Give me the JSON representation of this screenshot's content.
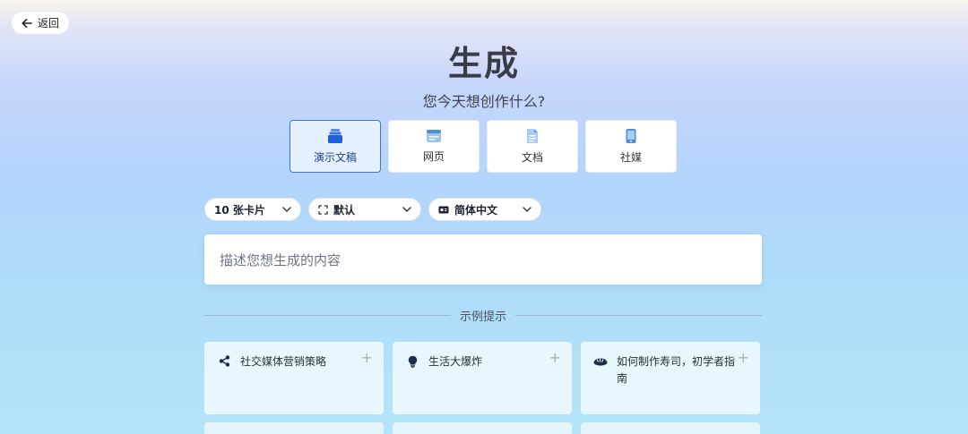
{
  "nav": {
    "back_label": "返回"
  },
  "header": {
    "title": "生成",
    "subtitle": "您今天想创作什么?"
  },
  "types": [
    {
      "label": "演示文稿",
      "icon": "presentation-icon",
      "active": true
    },
    {
      "label": "网页",
      "icon": "webpage-icon",
      "active": false
    },
    {
      "label": "文档",
      "icon": "document-icon",
      "active": false
    },
    {
      "label": "社媒",
      "icon": "social-media-icon",
      "active": false
    }
  ],
  "options": {
    "cards": "10 张卡片",
    "theme": "默认",
    "language": "简体中文"
  },
  "prompt": {
    "placeholder": "描述您想生成的内容"
  },
  "examples": {
    "heading": "示例提示",
    "items": [
      {
        "text": "社交媒体营销策略",
        "icon": "share-icon"
      },
      {
        "text": "生活大爆炸",
        "icon": "lightbulb-icon"
      },
      {
        "text": "如何制作寿司，初学者指南",
        "icon": "sushi-icon"
      }
    ]
  },
  "colors": {
    "accent": "#3f74d6",
    "active_bg": "#e6f1ff",
    "icon_blue": "#1f5fd6"
  }
}
